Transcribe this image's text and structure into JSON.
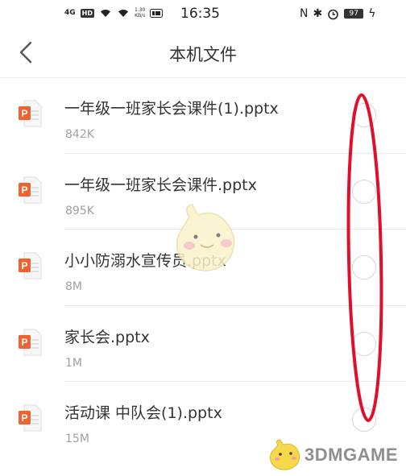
{
  "status_bar": {
    "network": "4G",
    "hd": "HD",
    "net_speed": "1.30",
    "net_speed_unit": "KB/s",
    "time": "16:35",
    "battery": "97"
  },
  "header": {
    "title": "本机文件"
  },
  "files": [
    {
      "name": "一年级一班家长会课件(1).pptx",
      "size": "842K",
      "icon": "ppt-file-icon"
    },
    {
      "name": "一年级一班家长会课件.pptx",
      "size": "895K",
      "icon": "ppt-file-icon"
    },
    {
      "name": "小小防溺水宣传员.pptx",
      "size": "8M",
      "icon": "ppt-file-icon"
    },
    {
      "name": "家长会.pptx",
      "size": "1M",
      "icon": "ppt-file-icon"
    },
    {
      "name": "活动课  中队会(1).pptx",
      "size": "15M",
      "icon": "ppt-file-icon"
    }
  ],
  "watermark": {
    "text": "3DMGAME"
  },
  "colors": {
    "ppt_orange": "#f0622f",
    "annotation_red": "#e0102a"
  }
}
